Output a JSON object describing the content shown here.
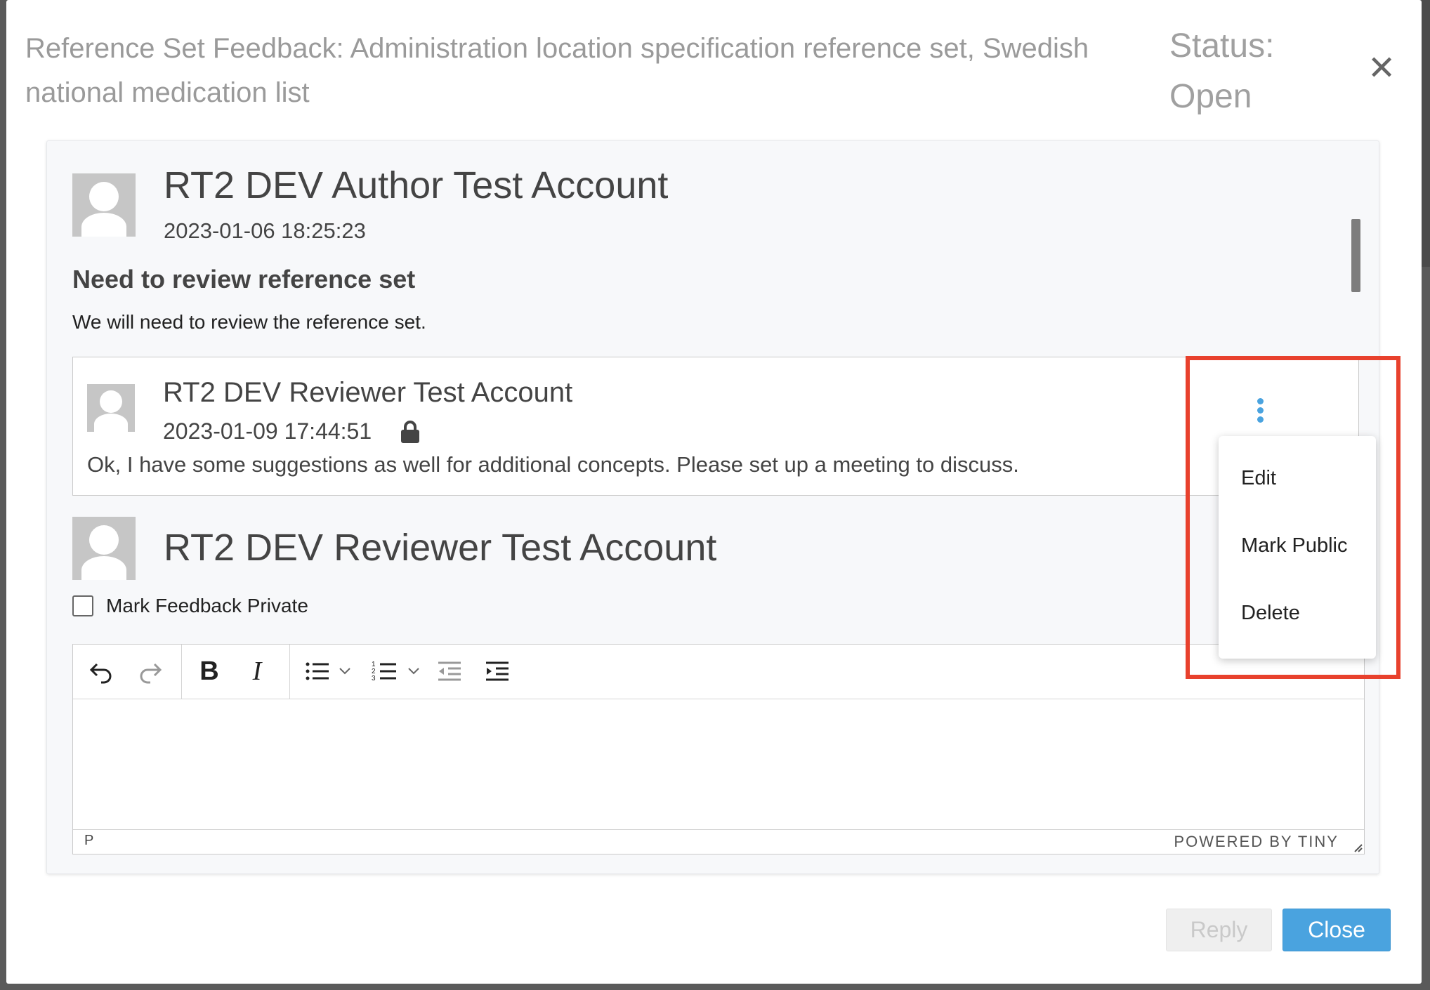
{
  "dialog": {
    "title": "Reference Set Feedback: Administration location specification reference set, Swedish national medication list",
    "status_label": "Status:",
    "status_value": "Open",
    "close_icon": "close-icon"
  },
  "feedback": {
    "author": "RT2 DEV Author Test Account",
    "timestamp": "2023-01-06 18:25:23",
    "title": "Need to review reference set",
    "body": "We will need to review the reference set."
  },
  "reply": {
    "author": "RT2 DEV Reviewer Test Account",
    "timestamp": "2023-01-09 17:44:51",
    "text": "Ok, I have some suggestions as well for additional concepts. Please set up a meeting to discuss.",
    "icon": "lock-icon"
  },
  "compose": {
    "author": "RT2 DEV Reviewer Test Account",
    "private_label": "Mark Feedback Private",
    "statusbar_path": "P",
    "powered_by": "POWERED BY TINY"
  },
  "toolbar": {
    "bold": "B",
    "italic": "I"
  },
  "context_menu": {
    "items": [
      "Edit",
      "Mark Public",
      "Delete"
    ]
  },
  "footer": {
    "reply_label": "Reply",
    "close_label": "Close"
  },
  "colors": {
    "accent": "#4aa3df",
    "highlight": "#e8412d"
  }
}
